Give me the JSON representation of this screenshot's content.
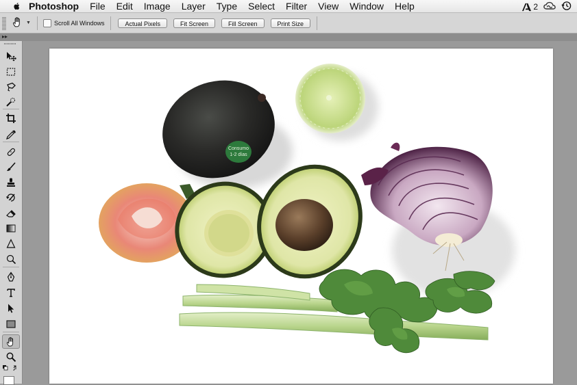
{
  "menubar": {
    "app_name": "Photoshop",
    "items": [
      "File",
      "Edit",
      "Image",
      "Layer",
      "Type",
      "Select",
      "Filter",
      "View",
      "Window",
      "Help"
    ],
    "tray": {
      "adobe_badge": "2"
    }
  },
  "options_bar": {
    "tool_icon": "hand-icon",
    "scroll_all_windows": {
      "label": "Scroll All Windows",
      "checked": false
    },
    "buttons": {
      "actual_pixels": "Actual Pixels",
      "fit_screen": "Fit Screen",
      "fill_screen": "Fill Screen",
      "print_size": "Print Size"
    }
  },
  "tools_panel": {
    "active_tool": "hand-tool",
    "tools": [
      "move-tool",
      "rectangular-marquee-tool",
      "lasso-tool",
      "quick-selection-tool",
      "crop-tool",
      "eyedropper-tool",
      "healing-brush-tool",
      "brush-tool",
      "clone-stamp-tool",
      "history-brush-tool",
      "eraser-tool",
      "gradient-tool",
      "blur-tool",
      "dodge-tool",
      "pen-tool",
      "type-tool",
      "path-selection-tool",
      "rectangle-tool",
      "hand-tool",
      "zoom-tool"
    ]
  },
  "document": {
    "photo_subject": "avocado, lime, tomato, halved avocado, red onion, celery on white",
    "sticker_text_line1": "Consumo",
    "sticker_text_line2": "1-2 días"
  },
  "colors": {
    "menubar_bg": "#ececec",
    "optionsbar_bg": "#d6d6d6",
    "tools_bg": "#d3d3d3",
    "workspace_bg": "#9a9a9a",
    "canvas_bg": "#ffffff"
  }
}
